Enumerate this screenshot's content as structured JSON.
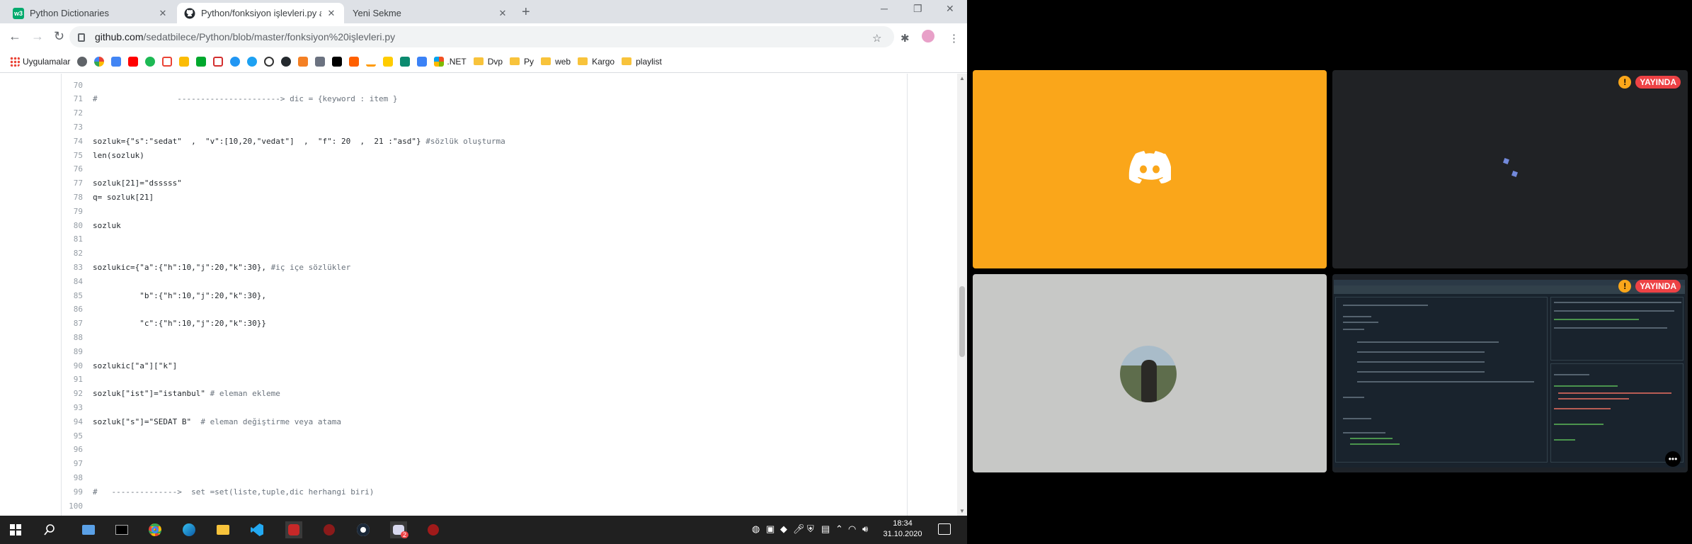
{
  "tabs": [
    {
      "title": "Python Dictionaries",
      "icon": "w3schools-icon",
      "active": false
    },
    {
      "title": "Python/fonksiyon işlevleri.py at master",
      "icon": "github-icon",
      "active": true
    },
    {
      "title": "Yeni Sekme",
      "icon": "",
      "active": false
    }
  ],
  "toolbar": {
    "url_host": "github.com",
    "url_path": "/sedatbilece/Python/blob/master/fonksiyon%20işlevleri.py"
  },
  "bookmarks": [
    {
      "label": "Uygulamalar",
      "icon": "apps-icon"
    },
    {
      "label": ".NET",
      "icon": "windows-icon"
    },
    {
      "label": "Dvp",
      "icon": "folder-icon"
    },
    {
      "label": "Py",
      "icon": "folder-icon"
    },
    {
      "label": "web",
      "icon": "folder-icon"
    },
    {
      "label": "Kargo",
      "icon": "folder-icon"
    },
    {
      "label": "playlist",
      "icon": "folder-icon"
    }
  ],
  "code": {
    "lines": [
      {
        "n": "70",
        "text": ""
      },
      {
        "n": "71",
        "text": "#                 ----------------------> dic = {keyword : item }",
        "comment": true
      },
      {
        "n": "72",
        "text": ""
      },
      {
        "n": "73",
        "text": ""
      },
      {
        "n": "74",
        "text": "sozluk={\"s\":\"sedat\"  ,  \"v\":[10,20,\"vedat\"]  ,  \"f\": 20  ,  21 :\"asd\"} ",
        "trail": "#sözlük oluşturma"
      },
      {
        "n": "75",
        "text": "len(sozluk)"
      },
      {
        "n": "76",
        "text": ""
      },
      {
        "n": "77",
        "text": "sozluk[21]=\"dsssss\""
      },
      {
        "n": "78",
        "text": "q= sozluk[21]"
      },
      {
        "n": "79",
        "text": ""
      },
      {
        "n": "80",
        "text": "sozluk"
      },
      {
        "n": "81",
        "text": ""
      },
      {
        "n": "82",
        "text": ""
      },
      {
        "n": "83",
        "text": "sozlukic={\"a\":{\"h\":10,\"j\":20,\"k\":30}, ",
        "trail": "#iç içe sözlükler"
      },
      {
        "n": "84",
        "text": ""
      },
      {
        "n": "85",
        "text": "          \"b\":{\"h\":10,\"j\":20,\"k\":30},"
      },
      {
        "n": "86",
        "text": ""
      },
      {
        "n": "87",
        "text": "          \"c\":{\"h\":10,\"j\":20,\"k\":30}}"
      },
      {
        "n": "88",
        "text": ""
      },
      {
        "n": "89",
        "text": ""
      },
      {
        "n": "90",
        "text": "sozlukic[\"a\"][\"k\"]"
      },
      {
        "n": "91",
        "text": ""
      },
      {
        "n": "92",
        "text": "sozluk[\"ist\"]=\"istanbul\" ",
        "trail": "# eleman ekleme"
      },
      {
        "n": "93",
        "text": ""
      },
      {
        "n": "94",
        "text": "sozluk[\"s\"]=\"SEDAT B\"  ",
        "trail": "# eleman değiştirme veya atama"
      },
      {
        "n": "95",
        "text": ""
      },
      {
        "n": "96",
        "text": ""
      },
      {
        "n": "97",
        "text": ""
      },
      {
        "n": "98",
        "text": ""
      },
      {
        "n": "99",
        "text": "#   -------------->  set =set(liste,tuple,dic herhangi biri)",
        "comment": true
      },
      {
        "n": "100",
        "text": ""
      }
    ]
  },
  "taskbar": {
    "time": "18:34",
    "date": "31.10.2020",
    "apps": [
      "windows-start-icon",
      "search-icon",
      "file-explorer-icon",
      "terminal-icon",
      "chrome-icon",
      "edge-icon",
      "folder-icon",
      "vscode-icon",
      "whatsapp-icon",
      "game-icon",
      "steam-icon",
      "discord-icon",
      "game2-icon"
    ],
    "discord_badge": "2"
  },
  "call": {
    "live_label": "YAYINDA",
    "tiles": [
      "discord-logo-tile",
      "stream-tile-1",
      "camera-tile",
      "stream-tile-2"
    ]
  },
  "colors": {
    "discord_orange": "#faa61a",
    "live_red": "#ed4245",
    "taskbar": "#202020"
  }
}
